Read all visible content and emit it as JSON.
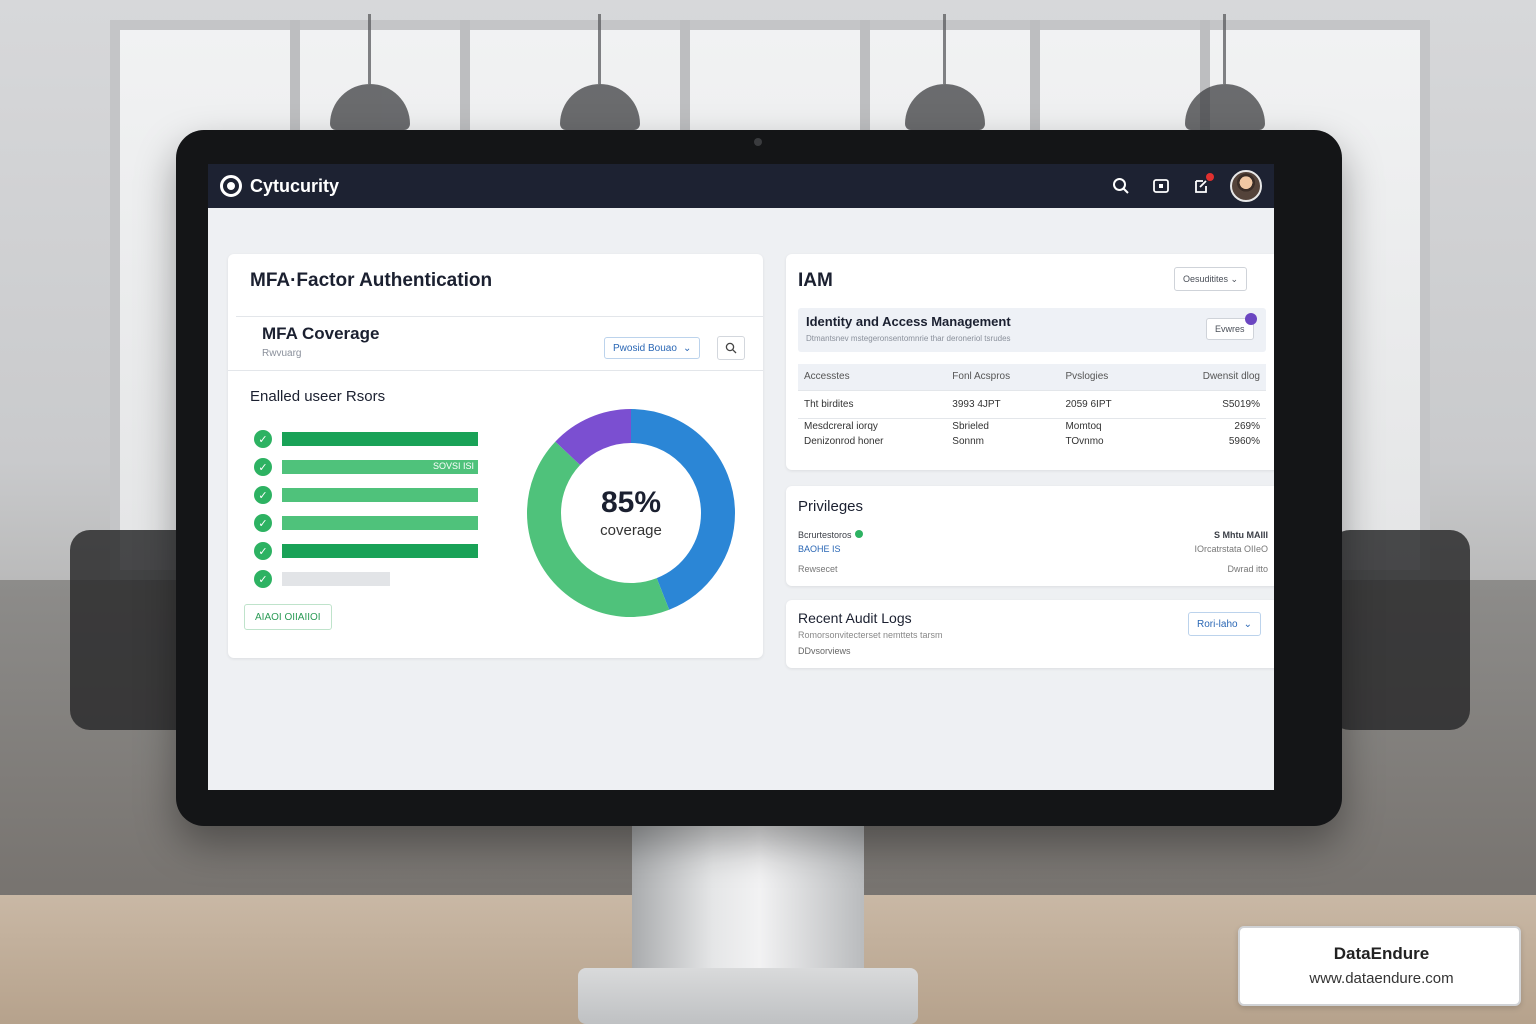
{
  "app": {
    "brand_name": "Cytucurity",
    "topbar_icons": [
      "search-icon",
      "window-icon",
      "notification-icon"
    ],
    "accent_color": "#1d2232"
  },
  "mfa_card": {
    "title": "MFA·Factor Authentication",
    "coverage_title": "MFA Coverage",
    "coverage_subtitle": "Rwvuarg",
    "filter_label": "Pwosid Bouao",
    "section_label": "Enalled useer Rsors",
    "bars": [
      {
        "level": 1.0,
        "text": "",
        "color": "#19a257"
      },
      {
        "level": 1.0,
        "text": "SOVSI ISI",
        "color": "#4fc27b"
      },
      {
        "level": 1.0,
        "text": "",
        "color": "#4fc27b"
      },
      {
        "level": 1.0,
        "text": "",
        "color": "#4fc27b"
      },
      {
        "level": 1.0,
        "text": "",
        "color": "#19a257"
      },
      {
        "level": 0.55,
        "text": "",
        "color": "#e2e4e7"
      }
    ],
    "action_button": "AIAOI OIIAIIOI",
    "donut": {
      "percent_label": "85%",
      "caption": "coverage",
      "segments": [
        {
          "fraction": 0.44,
          "color": "#2b86d6"
        },
        {
          "fraction": 0.43,
          "color": "#4fc27b"
        },
        {
          "fraction": 0.13,
          "color": "#7b4fd1"
        }
      ]
    }
  },
  "iam_card": {
    "title": "IAM",
    "top_button": "Oesuditites ⌄",
    "banner_title": "Identity and Access Management",
    "banner_desc": "Dtmantsnev mstegeronsentomnrie thar deroneriol tsrudes",
    "banner_button": "Evwres",
    "table": {
      "headers": [
        "Accesstes",
        "Fonl Acspros",
        "Pvslogies",
        "Dwensit dlog"
      ],
      "rows": [
        {
          "c1": "Tht birdites",
          "c2": "3993 4JPT",
          "c3": "2059 6IPT",
          "c4": "S5019%"
        },
        {
          "c1": "Mesdcreral iorqy|Denizonrod honer",
          "c2": "Sbrieled|Sonnm",
          "c3": "Momtoq|TOvnmo",
          "c4": "269%|5960%"
        }
      ]
    }
  },
  "privileges_card": {
    "title": "Privileges",
    "left_line1": "Bcrurtestoros",
    "left_line2": "BAOHE IS",
    "left_line3": "Rewsecet",
    "right_line1": "S Mhtu MAIII",
    "right_line2": "IOrcatrstata OIIeO",
    "right_line3": "Dwrad itto"
  },
  "audit_card": {
    "title": "Recent Audit Logs",
    "desc": "Romorsonvitecterset nemttets tarsm",
    "link": "DDvsorviews",
    "dropdown": "Rori-laho"
  },
  "watermark": {
    "name": "DataEndure",
    "url": "www.dataendure.com"
  }
}
